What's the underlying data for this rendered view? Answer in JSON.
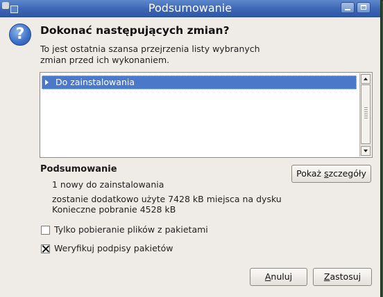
{
  "window": {
    "title": "Podsumowanie"
  },
  "header": {
    "icon": "question-icon",
    "heading": "Dokonać następujących zmian?",
    "description_line1": "To jest ostatnia szansa przejrzenia listy wybranych",
    "description_line2": "zmian przed ich wykonaniem."
  },
  "changes_list": {
    "items": [
      {
        "label": "Do zainstalowania",
        "selected": true,
        "expanded": false
      }
    ]
  },
  "summary": {
    "title": "Podsumowanie",
    "lines": [
      "1 nowy do zainstalowania",
      "zostanie dodatkowo użyte 7428 kB miejsca na dysku",
      "Konieczne pobranie 4528 kB"
    ],
    "details_button": {
      "label_pre": "Pokaż ",
      "label_mnemonic": "s",
      "label_post": "zczegóły"
    }
  },
  "options": [
    {
      "label": "Tylko pobieranie plików z pakietami",
      "checked": false
    },
    {
      "label": "Weryfikuj podpisy pakietów",
      "checked": true
    }
  ],
  "buttons": {
    "cancel": {
      "mnemonic": "A",
      "rest": "nuluj"
    },
    "apply": {
      "mnemonic": "Z",
      "rest": "astosuj"
    }
  },
  "colors": {
    "titlebar": "#3c66b3",
    "selection": "#4b78c8",
    "dialog_bg": "#efebe7"
  }
}
